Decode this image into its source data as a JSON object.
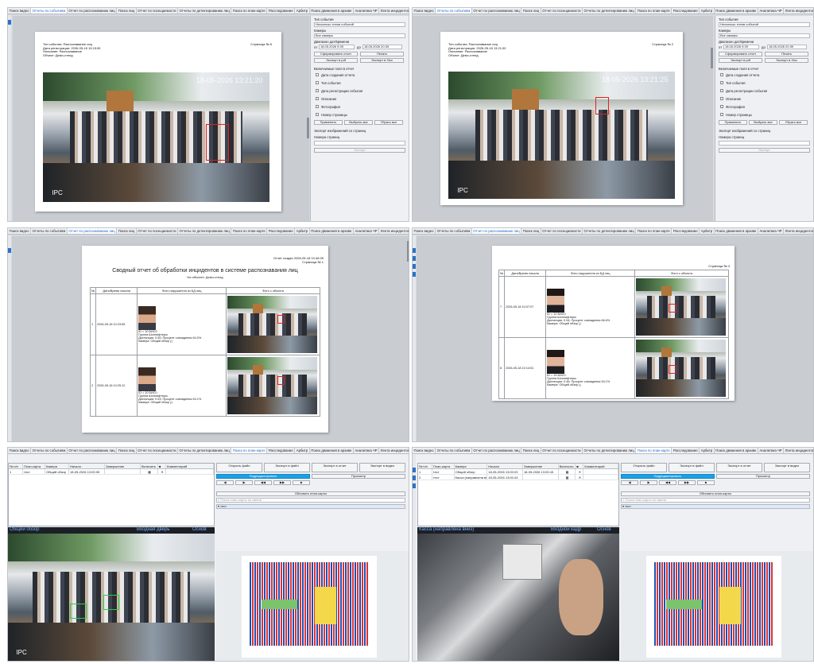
{
  "tabs": [
    "Поиск видео",
    "Отчеты по событиям",
    "Отчет по распознаванию лиц",
    "Поиск лиц",
    "Отчет по посещаемости",
    "Отчеты по детектированию лиц",
    "Поиск по план-карте",
    "Расследование",
    "Арбитр",
    "Поиск движения в архиве",
    "Аналитика ЧР",
    "Лента инцидентов"
  ],
  "tabs_short": [
    "Поиск видео",
    "Отчеты по событиям",
    "Отчет по распознаванию лиц",
    "Поиск лиц",
    "Отчет по посещаемости",
    "Отчеты по детектированию лиц",
    "Поиск по план-карте",
    "Расследование",
    "Арбитр",
    "Поиск движения в архиве",
    "Аналитика ЧР",
    "Лента инцидентов"
  ],
  "events_report": {
    "page1_header": [
      "Тип события: Распознавание лиц",
      "Дата регистрации: 2026-05-18 13:15:50",
      "Описание: Распознавание",
      "Объект: Демо-стенд"
    ],
    "page1_num": "Страница № 6",
    "page2_header": [
      "Тип события: Распознавание лиц",
      "Дата регистрации: 2026-05-18 13:21:52",
      "Описание: Распознавание",
      "Объект: Демо-стенд"
    ],
    "page2_num": "Страница № 2",
    "ts1": "18-05-2026 13:21:20",
    "ts2": "18-05-2026 13:21:25",
    "ipc": "IPC",
    "side": {
      "event_type_label": "Тип события",
      "event_type_value": "Несколько типов событий",
      "cameras_label": "Камеры",
      "cameras_value": "Все камеры",
      "range_label": "Диапазон дат/времени",
      "from": "от",
      "to": "до",
      "from_value": "18.05.2026 9:39",
      "to_value": "18.05.2026 20:39",
      "form_report": "Сформировать отчет",
      "print": "Печать",
      "export_pdf": "Экспорт в pdf",
      "export_xls": "Экспорт в Xlsx",
      "fields_label": "Включаемые поля в отчет",
      "fields": [
        "Дата создания отчета",
        "Тип события",
        "Дата регистрации события",
        "Описание",
        "Фотография",
        "Номер страницы"
      ],
      "apply": "Применить",
      "select_all": "Выбрать все",
      "remove_all": "Убрать все",
      "export_images_label": "Экспорт изображений со страниц",
      "pages_label": "Номера страниц",
      "export": "Экспорт"
    }
  },
  "face_report": {
    "created": "Отчет создан 2026-05-18 10:46:39",
    "page": "Страница № 1",
    "page_right": "Страница № 4",
    "title": "Сводный отчет об обработки инцидентов в системе распознавания лиц",
    "subtitle": "На объекте: Демо-стенд",
    "columns": [
      "№",
      "Дата/Время начала",
      "Фото нарушителя из БД лиц",
      "Фото с объекта"
    ],
    "rows_left": [
      {
        "n": "1",
        "time": "2026-05-18 10:23:55",
        "info": [
          "ID = 10 БИС0",
          "Группа Шоплифтеры",
          "Дистанция: 0.50; Процент совпадения 64.0%",
          "Камера: Общий обзор ()"
        ]
      },
      {
        "n": "2",
        "time": "2026-05-18 10:25:12",
        "info": [
          "ID = 10 БИС0",
          "Группа Шоплифтеры",
          "Дистанция: 0.53; Процент совпадения 63.1%",
          "Камера: Общий обзор ()"
        ]
      }
    ],
    "rows_right": [
      {
        "n": "7",
        "time": "2026-05-18 10:07:07",
        "info": [
          "ID = 12 БИС0",
          "Группа Шоплифтеры",
          "Дистанция: 0.54; Процент совпадения 66.6%",
          "Камера: Общий обзор ()"
        ]
      },
      {
        "n": "8",
        "time": "2026-05-18 10:14:51",
        "info": [
          "ID = 15 БИС0",
          "Группа Шоплифтеры",
          "Дистанция: 0.46; Процент совпадения 54.1%",
          "Камера: Общий обзор ()"
        ]
      }
    ]
  },
  "plan_search": {
    "columns": [
      "№ п/п",
      "План-карта",
      "Камера",
      "Начало",
      "Завершение",
      "Включить",
      "■",
      "Комментарий"
    ],
    "rows_left": [
      {
        "n": "1",
        "map": "тест",
        "cam": "Общий обзор",
        "start": "18-05-2026 13:00:05",
        "end": ""
      }
    ],
    "rows_right": [
      {
        "n": "1",
        "map": "тест",
        "cam": "Общий обзор",
        "start": "18-05-2026 13:00:03",
        "end": "18-05-2026 13:00:43"
      },
      {
        "n": "2",
        "map": "тест",
        "cam": "Касса (направлена вниз)",
        "start": "18-05-2026 13:00:43",
        "end": ""
      }
    ],
    "open_file": "Открыть файл",
    "export_file": "Экспорт в файл",
    "export_report": "Экспорт в отчет",
    "export_video": "Экспорт в видео",
    "podpredvarit": "Подредактировать",
    "view": "Просмотр",
    "update_maps": "Обновить план-карты",
    "search_placeholder": "Поиск план-карты по имени",
    "tree_item": "тест",
    "cam_labels_left": [
      "Общий обзор",
      "Входная дверь",
      "Основ"
    ],
    "cam_labels_right": [
      "Касса (направлена вниз)",
      "Входной кадр",
      "Основ"
    ]
  }
}
